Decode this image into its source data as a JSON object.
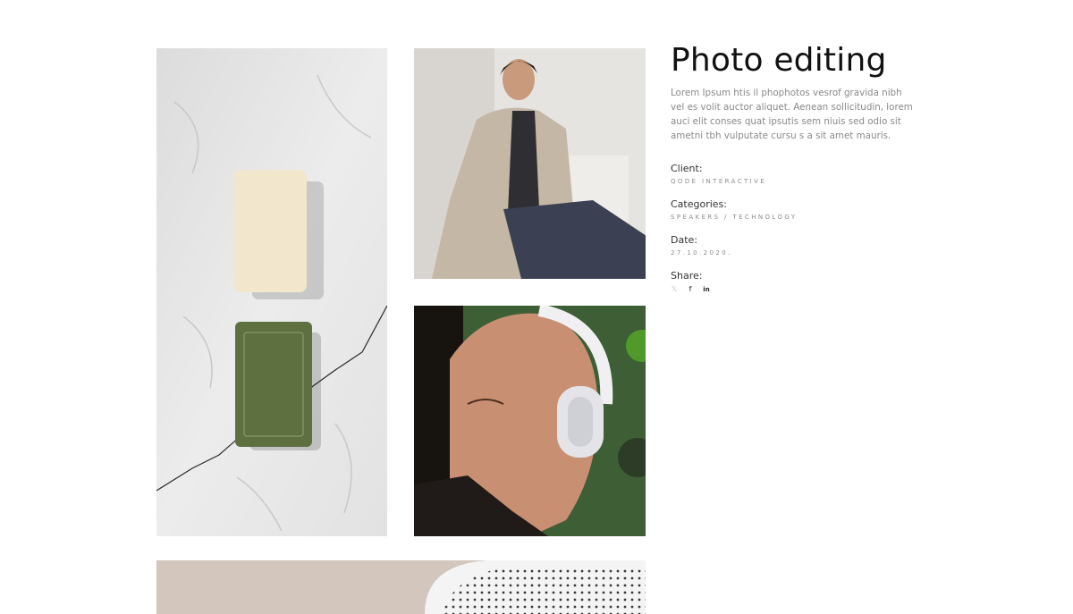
{
  "project": {
    "title": "Photo editing",
    "description": "Lorem Ipsum htis il phophotos vesrof gravida nibh vel es volit auctor aliquet. Aenean sollicitudin, lorem auci elit conses quat ipsutis sem niuis sed odio sit ametni tbh vulputate cursu s a sit amet mauris."
  },
  "meta": {
    "client_label": "Client:",
    "client_value": "Qode Interactive",
    "categories_label": "Categories:",
    "categories_value": "Speakers / Technology",
    "date_label": "Date:",
    "date_value": "27.10.2020.",
    "share_label": "Share:"
  },
  "share_icons": [
    {
      "name": "twitter-icon",
      "glyph": "𝕏"
    },
    {
      "name": "facebook-icon",
      "glyph": "f"
    },
    {
      "name": "linkedin-icon",
      "glyph": "in"
    }
  ],
  "colors": {
    "background": "#ffffff",
    "title": "#111111",
    "body_text": "#8a8a8a"
  }
}
